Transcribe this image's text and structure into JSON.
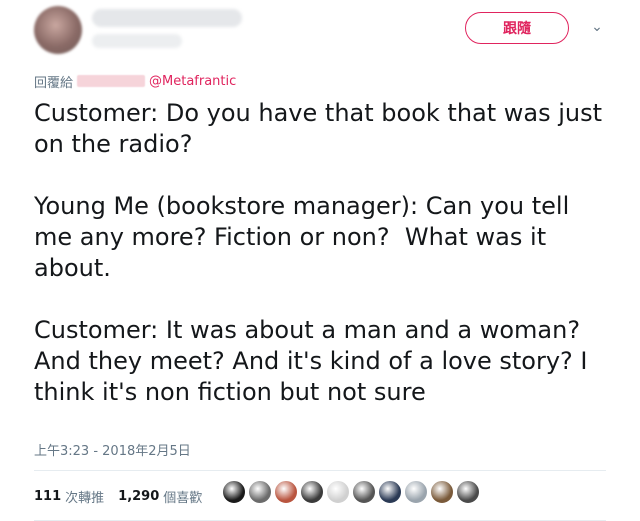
{
  "header": {
    "follow_label": "跟隨",
    "caret_icon": "chevron-down-icon"
  },
  "reply": {
    "prefix": "回覆給",
    "mention": "@Metafrantic"
  },
  "tweet": {
    "text": "Customer: Do you have that book that was just on the radio?\n\nYoung Me (bookstore manager): Can you tell me any more? Fiction or non?  What was it about.\n\nCustomer: It was about a man and a woman? And they meet? And it's kind of a love story? I think it's non fiction but not sure",
    "timestamp": "上午3:23 - 2018年2月5日"
  },
  "stats": {
    "retweets_count": "111",
    "retweets_label": "次轉推",
    "likes_count": "1,290",
    "likes_label": "個喜歡"
  },
  "colors": {
    "accent": "#e0245e",
    "muted": "#657786",
    "text": "#14171a"
  },
  "liker_avatars": [
    "#1a1a1a",
    "#6b6b6b",
    "#b9553f",
    "#3b3b3b",
    "#d0d0d0",
    "#555555",
    "#2b3a55",
    "#9aa4ad",
    "#7a5a3a",
    "#4a4a4a"
  ]
}
